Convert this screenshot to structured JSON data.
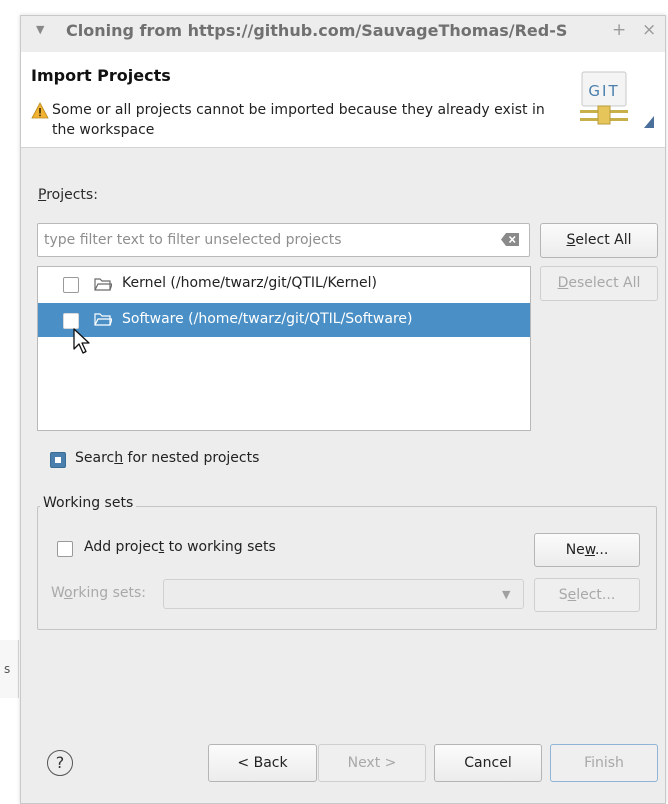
{
  "window": {
    "title": "Cloning from https://github.com/SauvageThomas/Red-S",
    "plus_glyph": "+",
    "close_glyph": "×"
  },
  "header": {
    "title": "Import Projects",
    "warning": "Some or all projects cannot be imported because they already exist in the workspace",
    "logo_text": "GIT"
  },
  "projects": {
    "label_first": "P",
    "label_rest": "rojects:",
    "filter_placeholder": "type filter text to filter unselected projects",
    "items": [
      {
        "label": "Kernel (/home/twarz/git/QTIL/Kernel)",
        "checked": false,
        "selected": false
      },
      {
        "label": "Software (/home/twarz/git/QTIL/Software)",
        "checked": false,
        "selected": true
      }
    ],
    "select_all_u": "S",
    "select_all_rest": "elect All",
    "deselect_all_u": "D",
    "deselect_all_rest": "eselect All"
  },
  "nested": {
    "label_pre": "Searc",
    "label_u": "h",
    "label_post": " for nested projects",
    "checked": true
  },
  "working_sets": {
    "group_title": "Working sets",
    "add_pre": "Add projec",
    "add_u": "t",
    "add_post": " to working sets",
    "new_pre": "Ne",
    "new_u": "w",
    "new_post": "...",
    "ws_pre": "W",
    "ws_u": "o",
    "ws_post": "rking sets:",
    "select_pre": "S",
    "select_u": "e",
    "select_post": "lect..."
  },
  "footer": {
    "help": "?",
    "back": "< Back",
    "next": "Next >",
    "cancel": "Cancel",
    "finish": "Finish"
  },
  "side_fragment": "s",
  "colors": {
    "selection": "#4a90c7",
    "dialog_bg": "#ededed",
    "warning": "#f2b233"
  }
}
